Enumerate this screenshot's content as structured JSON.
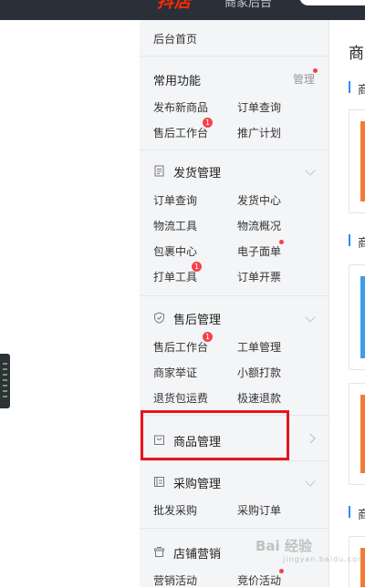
{
  "header": {
    "brand": "抖店",
    "subtitle": "商家后台"
  },
  "sidebar": {
    "home": "后台首页",
    "common": {
      "title": "常用功能",
      "manage": "管理",
      "items": [
        {
          "label": "发布新商品"
        },
        {
          "label": "订单查询"
        },
        {
          "label": "售后工作台",
          "badge": "1"
        },
        {
          "label": "推广计划"
        }
      ]
    },
    "shipping": {
      "title": "发货管理",
      "items": [
        {
          "label": "订单查询"
        },
        {
          "label": "发货中心"
        },
        {
          "label": "物流工具"
        },
        {
          "label": "物流概况"
        },
        {
          "label": "包裹中心"
        },
        {
          "label": "电子面单"
        },
        {
          "label": "打单工具",
          "badge": "1"
        },
        {
          "label": "订单开票"
        }
      ]
    },
    "aftersale": {
      "title": "售后管理",
      "items": [
        {
          "label": "售后工作台",
          "badge": "1"
        },
        {
          "label": "工单管理"
        },
        {
          "label": "商家举证"
        },
        {
          "label": "小额打款"
        },
        {
          "label": "退货包运费"
        },
        {
          "label": "极速退款"
        }
      ]
    },
    "product": {
      "title": "商品管理"
    },
    "purchase": {
      "title": "采购管理",
      "items": [
        {
          "label": "批发采购"
        },
        {
          "label": "采购订单"
        }
      ]
    },
    "marketing": {
      "title": "店铺营销",
      "items": [
        {
          "label": "营销活动"
        },
        {
          "label": "竞价活动"
        }
      ]
    }
  },
  "main": {
    "title": "商",
    "sub_heads": [
      "商",
      "商",
      "商"
    ]
  },
  "colors": {
    "highlight": "#e8141e",
    "badge": "#f5414b",
    "accent": "#2d8cf0",
    "card_orange": "#f47a35",
    "card_blue": "#3d9be9"
  },
  "watermark": {
    "text": "Bai 经验",
    "sub": "jingyan.baidu.com"
  }
}
